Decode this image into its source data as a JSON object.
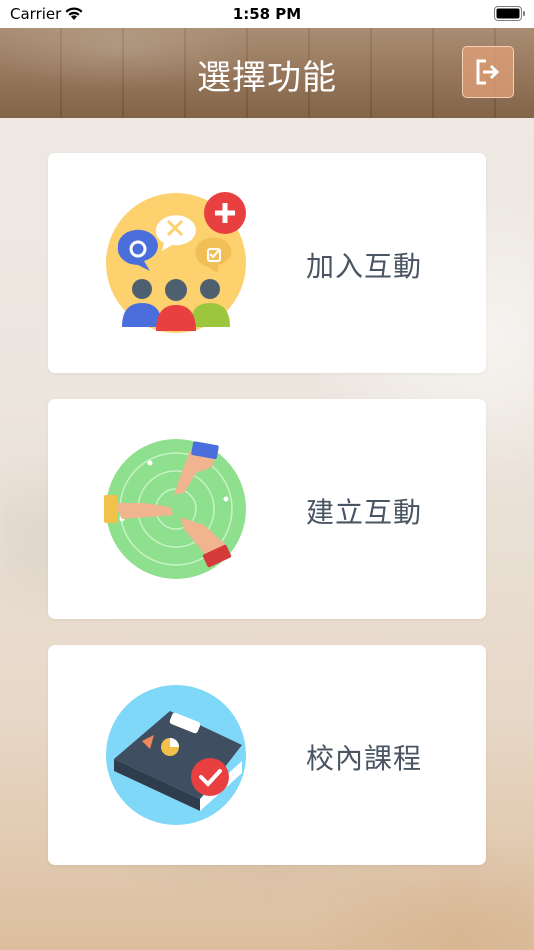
{
  "status_bar": {
    "carrier": "Carrier",
    "time": "1:58 PM",
    "wifi_icon": "wifi-icon",
    "battery_icon": "battery-icon"
  },
  "nav": {
    "title": "選擇功能",
    "logout_icon": "logout-icon"
  },
  "menu": [
    {
      "label": "加入互動",
      "icon": "join-interaction-icon"
    },
    {
      "label": "建立互動",
      "icon": "create-interaction-icon"
    },
    {
      "label": "校內課程",
      "icon": "school-course-icon"
    }
  ],
  "colors": {
    "nav_brown": "#8e6d50",
    "logout_button": "#e1a078",
    "card_text": "#4a5563",
    "icon_yellow": "#fdd16e",
    "icon_green": "#8fe08e",
    "icon_blue": "#7fd8f7",
    "accent_red": "#e84040"
  }
}
